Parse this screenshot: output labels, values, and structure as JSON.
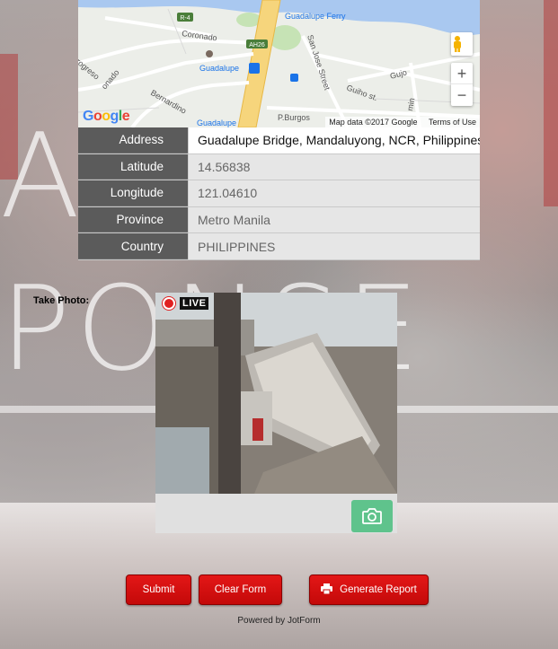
{
  "map": {
    "labels": {
      "r4": "R-4",
      "ah26": "AH26",
      "ferry": "Guadalupe Ferry",
      "coronado": "Coronado",
      "guadalupe_station": "Guadalupe",
      "san_jose": "San Jose Street",
      "gujo": "Gujo",
      "guiho": "Guiho st.",
      "bernardino": "Bernardino",
      "progreso": "Progreso",
      "onado": "onado",
      "burgos": "P.Burgos",
      "guadalupe_bottom": "Guadalupe",
      "min": "min",
      "google": "Google"
    },
    "zoom_in": "+",
    "zoom_out": "−",
    "map_data": "Map data ©2017 Google",
    "terms": "Terms of Use"
  },
  "info": {
    "rows": [
      {
        "label": "Address",
        "value": "Guadalupe Bridge, Mandaluyong, NCR, Philippines"
      },
      {
        "label": "Latitude",
        "value": "14.56838"
      },
      {
        "label": "Longitude",
        "value": "121.04610"
      },
      {
        "label": "Province",
        "value": "Metro Manila"
      },
      {
        "label": "Country",
        "value": "PHILIPPINES"
      }
    ]
  },
  "photo": {
    "label": "Take Photo:",
    "live": "LIVE"
  },
  "buttons": {
    "submit": "Submit",
    "clear": "Clear Form",
    "report": "Generate Report"
  },
  "footer": {
    "powered": "Powered by JotForm"
  },
  "colors": {
    "button_red": "#d31010",
    "camera_green": "#5fc38c",
    "label_bg": "#5b5b5b"
  }
}
